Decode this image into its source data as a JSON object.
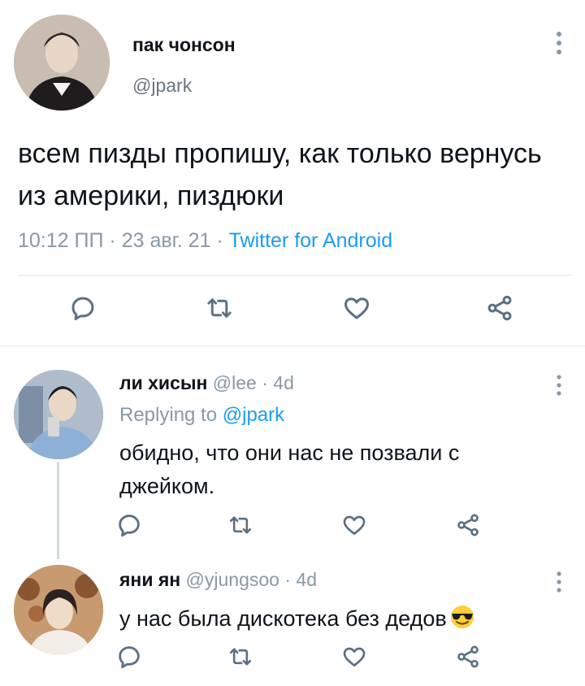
{
  "main_tweet": {
    "name": "пак чонсон",
    "handle": "@jpark",
    "text": "всем пизды пропишу, как только вернусь из америки, пиздюки",
    "time": "10:12 ПП",
    "date": "23 авг. 21",
    "source": "Twitter for Android"
  },
  "replies": [
    {
      "name": "ли хисын",
      "handle": "@lee",
      "age": "4d",
      "replying_label": "Replying to",
      "replying_to": "@jpark",
      "text": "обидно, что они нас не позвали с джейком."
    },
    {
      "name": "яни ян",
      "handle": "@yjungsoo",
      "age": "4d",
      "text": "у нас была дискотека без дедов",
      "emoji": "smiling-face-with-sunglasses"
    }
  ],
  "colors": {
    "link": "#1d9bf0",
    "muted": "#8899a6",
    "icon": "#5b7083",
    "divider": "#e1e8ed"
  }
}
